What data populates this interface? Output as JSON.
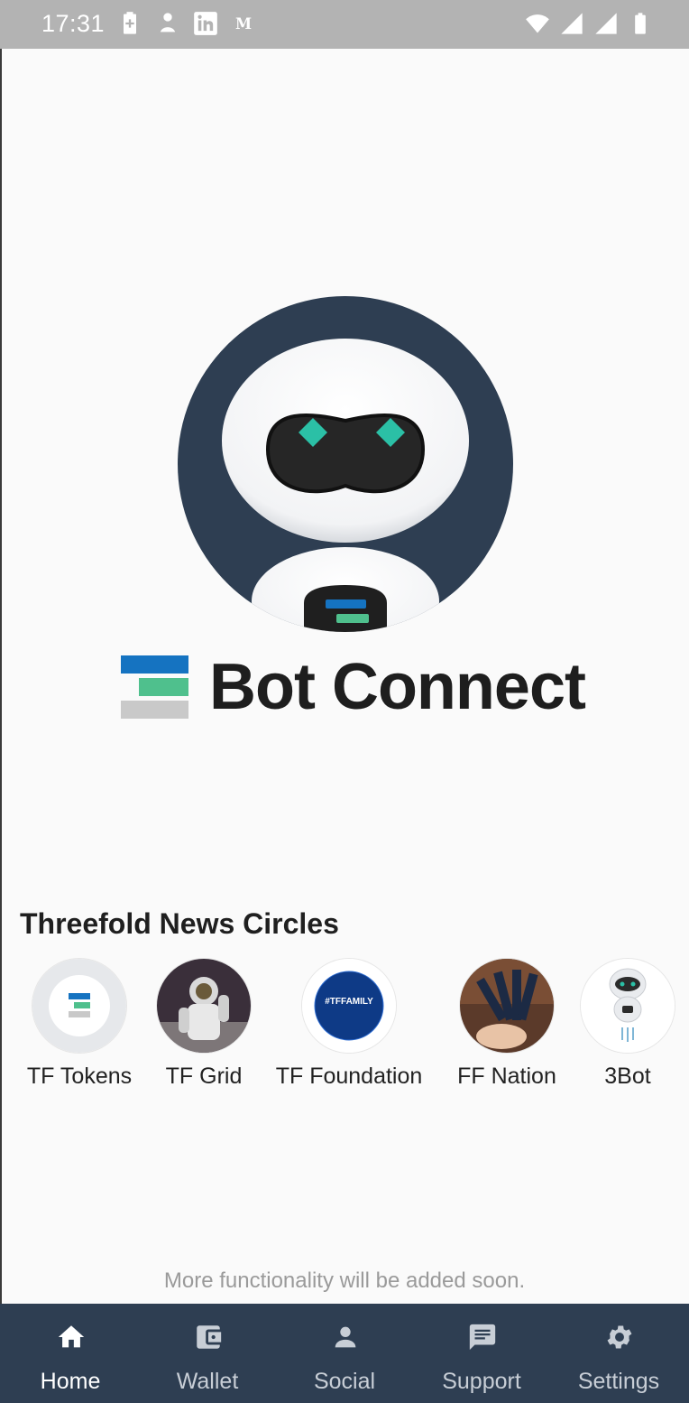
{
  "status_bar": {
    "time": "17:31"
  },
  "brand": {
    "title": "Bot Connect"
  },
  "news": {
    "heading": "Threefold News Circles",
    "circles": [
      {
        "label": "TF Tokens"
      },
      {
        "label": "TF Grid"
      },
      {
        "label": "TF Foundation",
        "badge_text": "#TFFAMILY"
      },
      {
        "label": "FF Nation"
      },
      {
        "label": "3Bot"
      }
    ]
  },
  "footer": {
    "note": "More functionality will be added soon."
  },
  "nav": {
    "items": [
      {
        "label": "Home",
        "icon": "home-icon",
        "active": true
      },
      {
        "label": "Wallet",
        "icon": "wallet-icon"
      },
      {
        "label": "Social",
        "icon": "person-icon"
      },
      {
        "label": "Support",
        "icon": "chat-icon"
      },
      {
        "label": "Settings",
        "icon": "gear-icon"
      }
    ]
  },
  "colors": {
    "nav_bg": "#2e3e52",
    "avatar_bg": "#2e3e52",
    "brand_blue": "#1573c1",
    "brand_green": "#4fc08d",
    "brand_gray": "#c9c9c9"
  }
}
